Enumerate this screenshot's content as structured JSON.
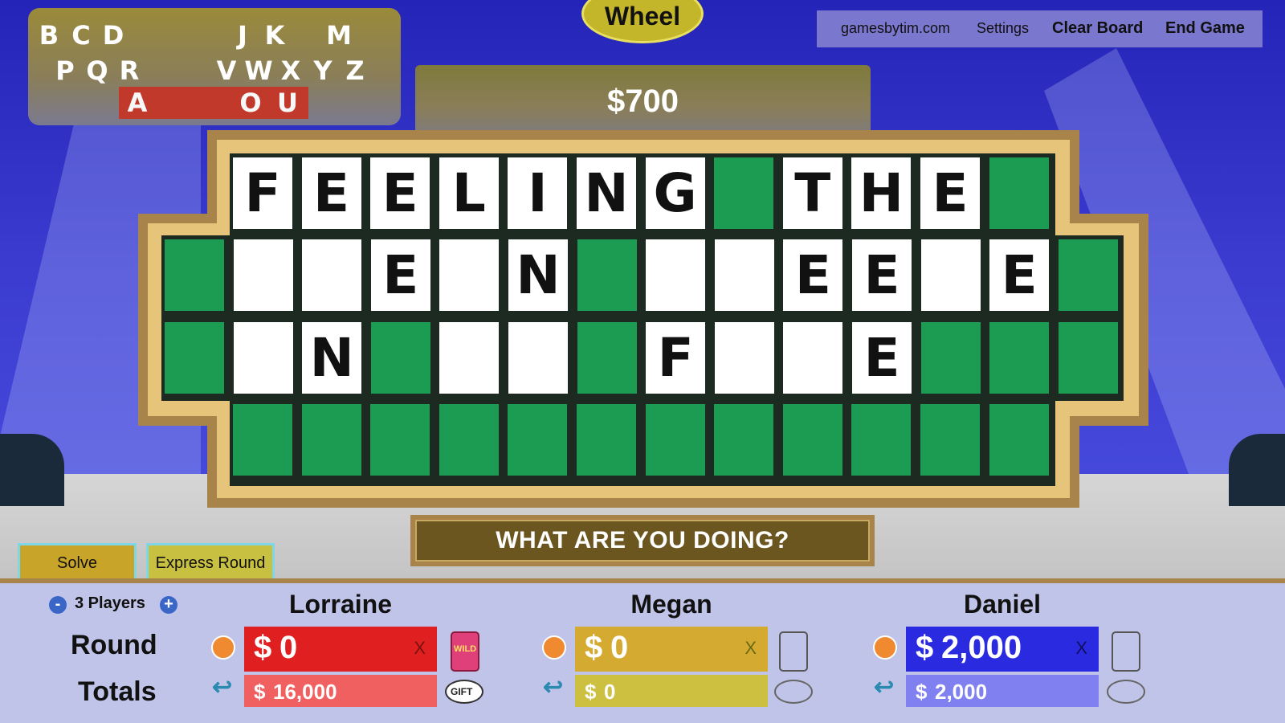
{
  "letters": {
    "row1": [
      "B",
      "C",
      "D",
      "J",
      "K",
      "M"
    ],
    "row2": [
      "P",
      "Q",
      "R",
      "V",
      "W",
      "X",
      "Y",
      "Z"
    ],
    "row3": [
      "A",
      "O",
      "U"
    ]
  },
  "wheel_label": "Wheel",
  "nav": {
    "site": "gamesbytim.com",
    "settings": "Settings",
    "clear_board": "Clear Board",
    "end_game": "End Game"
  },
  "amount": "$700",
  "board": {
    "rows": [
      [
        "F",
        "E",
        "E",
        "L",
        "I",
        "N",
        "G",
        "#",
        "T",
        "H",
        "E",
        "#"
      ],
      [
        "#",
        "",
        "",
        "E",
        "",
        "N",
        "#",
        "",
        "",
        "E",
        "E",
        "",
        "E",
        "#"
      ],
      [
        "#",
        "",
        "N",
        "#",
        "",
        "",
        "#",
        "F",
        "",
        "",
        "E",
        "#",
        "#",
        "#"
      ],
      [
        "#",
        "#",
        "#",
        "#",
        "#",
        "#",
        "#",
        "#",
        "#",
        "#",
        "#",
        "#"
      ]
    ]
  },
  "category": "WHAT ARE YOU DOING?",
  "buttons": {
    "solve": "Solve",
    "express": "Express Round"
  },
  "players_control": {
    "minus": "-",
    "label": "3 Players",
    "plus": "+"
  },
  "labels": {
    "round": "Round",
    "totals": "Totals"
  },
  "players": [
    {
      "name": "Lorraine",
      "round": "0",
      "total": "16,000",
      "round_color": "#e02020",
      "total_color": "#f06060",
      "wild": "WILD",
      "gift": "GIFT"
    },
    {
      "name": "Megan",
      "round": "0",
      "total": "0",
      "round_color": "#d4aa30",
      "total_color": "#cdbf40"
    },
    {
      "name": "Daniel",
      "round": "2,000",
      "total": "2,000",
      "round_color": "#2a2ae0",
      "total_color": "#8080f0"
    }
  ],
  "currency": "$",
  "x_mark": "X",
  "colors": {
    "tile_green": "#1b9c52",
    "tile_white": "#ffffff",
    "frame": "#a8844a"
  }
}
